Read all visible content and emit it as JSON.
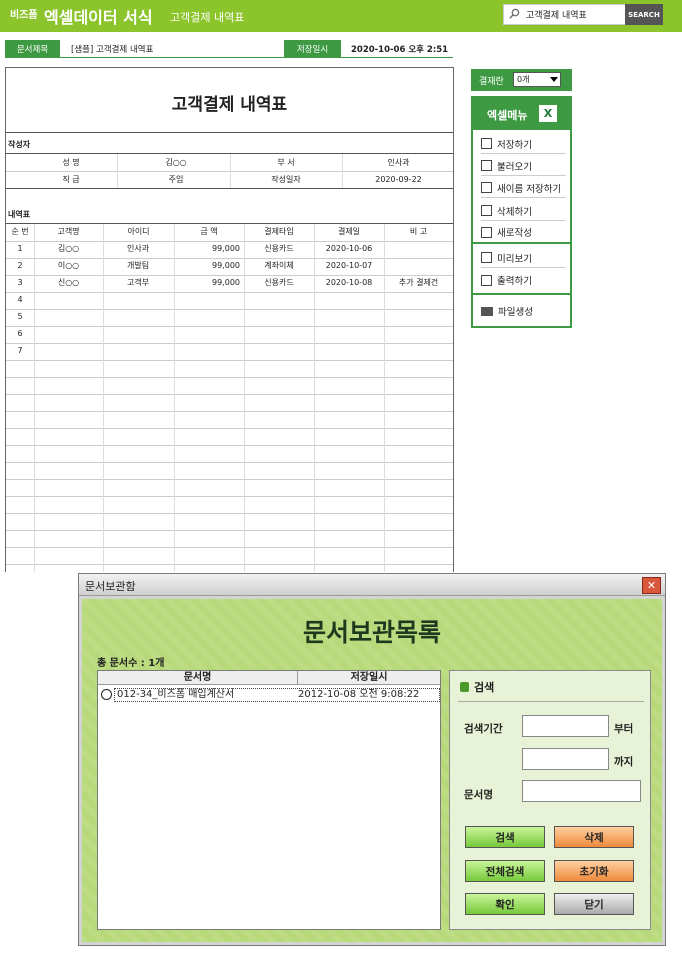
{
  "header": {
    "brand_small": "비즈폼",
    "brand_big": "엑셀데이터 서식",
    "subtitle": "고객결제 내역표",
    "search_value": "고객결제 내역표",
    "search_button": "SEARCH"
  },
  "info": {
    "doc_title_label": "문서제목",
    "doc_title": "[샘플] 고객결제 내역표",
    "saved_label": "저장일시",
    "saved_value": "2020-10-06  오후 2:51"
  },
  "sheet": {
    "title": "고객결제 내역표",
    "author_section": "작성자",
    "author": {
      "name_label": "성  명",
      "name": "김○○",
      "dept_label": "부  서",
      "dept": "인사과",
      "rank_label": "직  급",
      "rank": "주임",
      "date_label": "작성일자",
      "date": "2020-09-22"
    },
    "detail_section": "내역표",
    "columns": [
      "순 번",
      "고객명",
      "아이디",
      "금  액",
      "결제타입",
      "결제일",
      "비  고"
    ],
    "rows": [
      [
        "1",
        "김○○",
        "인사과",
        "99,000",
        "신용카드",
        "2020-10-06",
        ""
      ],
      [
        "2",
        "이○○",
        "개발팀",
        "99,000",
        "계좌이체",
        "2020-10-07",
        ""
      ],
      [
        "3",
        "신○○",
        "고객부",
        "99,000",
        "신용카드",
        "2020-10-08",
        "추가 결제건"
      ],
      [
        "4",
        "",
        "",
        "",
        "",
        "",
        ""
      ],
      [
        "5",
        "",
        "",
        "",
        "",
        "",
        ""
      ],
      [
        "6",
        "",
        "",
        "",
        "",
        "",
        ""
      ],
      [
        "7",
        "",
        "",
        "",
        "",
        "",
        ""
      ]
    ]
  },
  "panel": {
    "approval_label": "결재란",
    "approval_value": "0개",
    "menu_title": "엑셀메뉴",
    "items": [
      "저장하기",
      "불러오기",
      "새이름 저장하기",
      "삭제하기",
      "새로작성",
      "미리보기",
      "출력하기",
      "파일생성"
    ]
  },
  "dialog": {
    "window_title": "문서보관함",
    "heading": "문서보관목록",
    "count": "총 문서수 : 1개",
    "col_name": "문서명",
    "col_saved": "저장일시",
    "row_name": "012-34_비즈폼 매입계산서",
    "row_saved": "2012-10-08 오전 9:08:22",
    "search_title": "검색",
    "period_label": "검색기간",
    "from_label": "부터",
    "to_label": "까지",
    "docname_label": "문서명",
    "btn_search": "검색",
    "btn_delete": "삭제",
    "btn_search_all": "전체검색",
    "btn_reset": "초기화",
    "btn_ok": "확인",
    "btn_close": "닫기"
  }
}
